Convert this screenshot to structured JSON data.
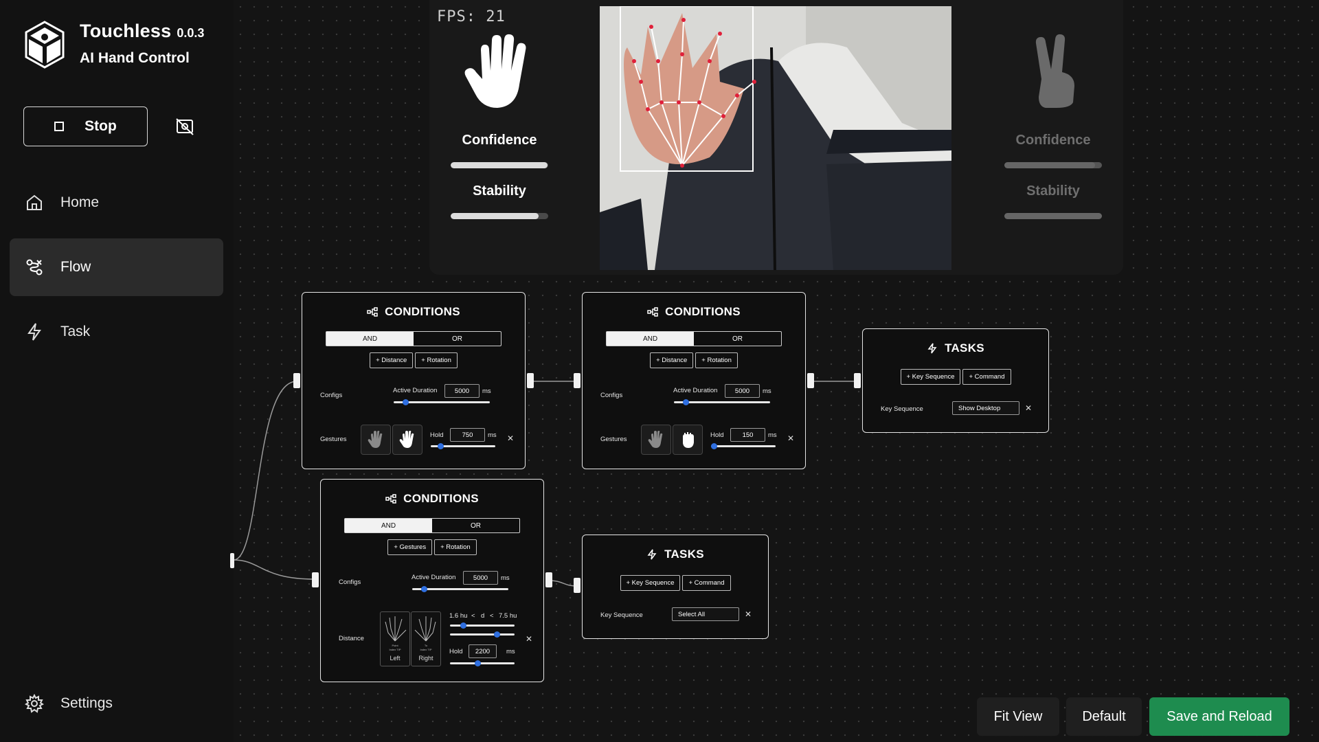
{
  "app": {
    "name": "Touchless",
    "version": "0.0.3",
    "subtitle": "AI Hand Control"
  },
  "controls": {
    "stop_label": "Stop",
    "camera_toggle_icon": "camera-off-icon"
  },
  "nav": {
    "items": [
      {
        "label": "Home",
        "icon": "home-icon",
        "active": false
      },
      {
        "label": "Flow",
        "icon": "flow-icon",
        "active": true
      },
      {
        "label": "Task",
        "icon": "bolt-icon",
        "active": false
      }
    ],
    "settings_label": "Settings"
  },
  "camera": {
    "fps_text": "FPS: 21",
    "left_hand": {
      "icon": "open-palm-icon",
      "confidence_label": "Confidence",
      "stability_label": "Stability",
      "confidence": 0.99,
      "stability": 0.9
    },
    "right_hand": {
      "icon": "victory-hand-icon",
      "confidence_label": "Confidence",
      "stability_label": "Stability",
      "confidence": 0.93,
      "stability": 1.0
    }
  },
  "nodes": {
    "cond1": {
      "title": "CONDITIONS",
      "and": "AND",
      "or": "OR",
      "add_buttons": [
        "+ Distance",
        "+ Rotation"
      ],
      "configs_label": "Configs",
      "active_duration_label": "Active Duration",
      "active_duration": "5000",
      "unit": "ms",
      "active_duration_level": 0.12,
      "gestures_label": "Gestures",
      "hold_label": "Hold",
      "hold": "750",
      "hold_level": 0.15,
      "remove": "✕"
    },
    "cond2": {
      "title": "CONDITIONS",
      "and": "AND",
      "or": "OR",
      "add_buttons": [
        "+ Distance",
        "+ Rotation"
      ],
      "configs_label": "Configs",
      "active_duration_label": "Active Duration",
      "active_duration": "5000",
      "unit": "ms",
      "active_duration_level": 0.12,
      "gestures_label": "Gestures",
      "hold_label": "Hold",
      "hold": "150",
      "hold_level": 0.04,
      "remove": "✕"
    },
    "cond3": {
      "title": "CONDITIONS",
      "and": "AND",
      "or": "OR",
      "add_buttons": [
        "+ Gestures",
        "+ Rotation"
      ],
      "configs_label": "Configs",
      "active_duration_label": "Active Duration",
      "active_duration": "5000",
      "unit": "ms",
      "active_duration_level": 0.12,
      "distance_label": "Distance",
      "range_min": "1.6 hu",
      "range_lt1": "<",
      "range_d": "d",
      "range_lt2": "<",
      "range_max": "7.5 hu",
      "range_min_level": 0.2,
      "range_max_level": 0.72,
      "left_card": {
        "top": "Point",
        "mid": "Index TIP",
        "caption": "Left"
      },
      "right_card": {
        "top": "To",
        "mid": "Index TIP",
        "caption": "Right"
      },
      "hold_label": "Hold",
      "hold": "2200",
      "hold_level": 0.43,
      "remove": "✕"
    },
    "task1": {
      "title": "TASKS",
      "add_buttons": [
        "+ Key Sequence",
        "+ Command"
      ],
      "field_label": "Key Sequence",
      "value": "Show Desktop",
      "remove": "✕"
    },
    "task2": {
      "title": "TASKS",
      "add_buttons": [
        "+ Key Sequence",
        "+ Command"
      ],
      "field_label": "Key Sequence",
      "value": "Select All",
      "remove": "✕"
    }
  },
  "actions": {
    "fit_view": "Fit View",
    "default": "Default",
    "save_reload": "Save and Reload"
  },
  "colors": {
    "accent_green": "#1e8c4f",
    "slider_knob": "#2f6fe0",
    "background": "#141414"
  }
}
